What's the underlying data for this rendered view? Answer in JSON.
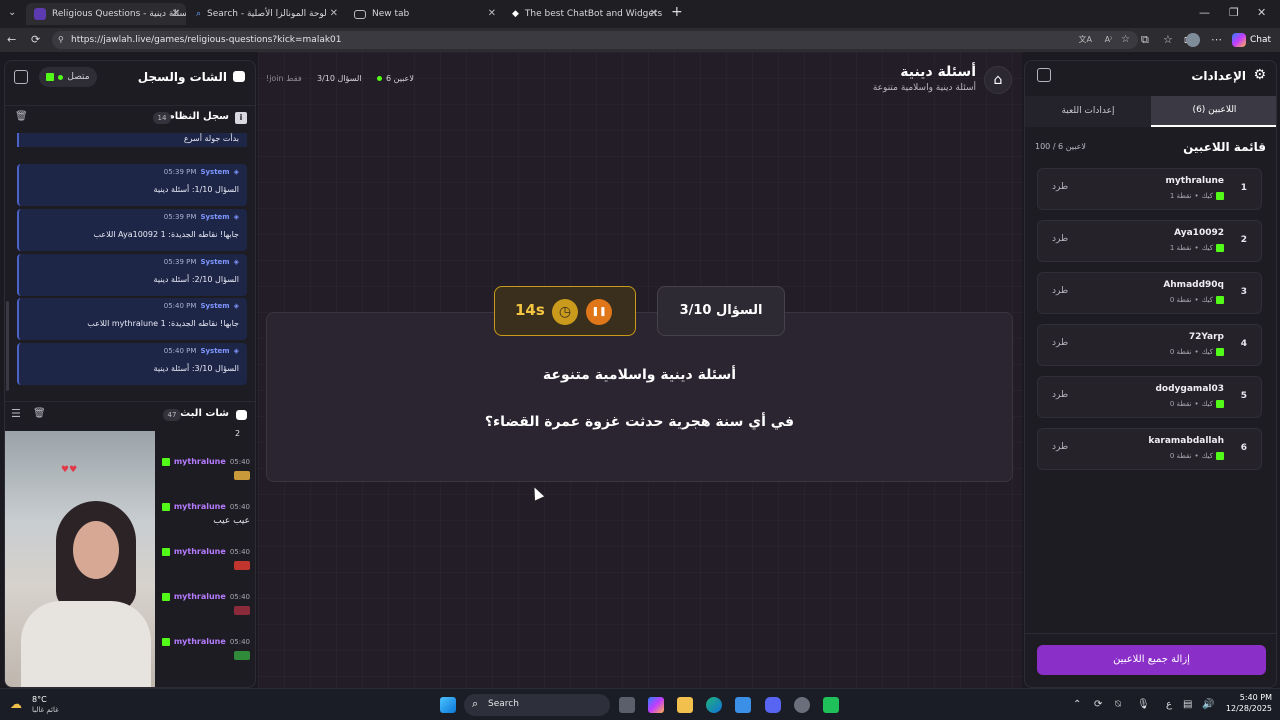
{
  "browser": {
    "tabs": [
      {
        "title": "Religious Questions - أسئلة دينية |",
        "active": true
      },
      {
        "title": "Search - لوحة المونالزا الأصلية"
      },
      {
        "title": "New tab"
      },
      {
        "title": "The best ChatBot and Widgets for"
      }
    ],
    "url": "https://jawlah.live/games/religious-questions?kick=malak01",
    "copilot_label": "Chat"
  },
  "chat_panel": {
    "title": "الشات والسجل",
    "status": "متصل",
    "system_log": {
      "title": "سجل النظام",
      "count": "14",
      "partial_text": "بدأت جولة أسرع",
      "messages": [
        {
          "sender": "System",
          "time": "05:39 PM",
          "text": "السؤال 1/10: أسئلة دينية"
        },
        {
          "sender": "System",
          "time": "05:39 PM",
          "text": "اللاعب Aya10092 جابها! نقاطه الجديدة: 1"
        },
        {
          "sender": "System",
          "time": "05:39 PM",
          "text": "السؤال 2/10: أسئلة دينية"
        },
        {
          "sender": "System",
          "time": "05:40 PM",
          "text": "اللاعب mythralune جابها! نقاطه الجديدة: 1"
        },
        {
          "sender": "System",
          "time": "05:40 PM",
          "text": "السؤال 3/10: أسئلة دينية"
        }
      ]
    },
    "stream_chat": {
      "title": "شات البث",
      "count": "47",
      "partial_text": "2",
      "messages": [
        {
          "time": "05:40",
          "user": "mythralune",
          "text": "",
          "emote": "#c99a3a"
        },
        {
          "time": "05:40",
          "user": "mythralune",
          "text": "عيب عيب",
          "emote": ""
        },
        {
          "time": "05:40",
          "user": "mythralune",
          "text": "",
          "emote": "#c2352f"
        },
        {
          "time": "05:40",
          "user": "mythralune",
          "text": "",
          "emote": "#8a2a3a"
        },
        {
          "time": "05:40",
          "user": "mythralune",
          "text": "",
          "emote": "#2f8a3a"
        }
      ]
    }
  },
  "game_header": {
    "title": "أسئلة دينية",
    "subtitle": "أسئلة دينية واسلامية متنوعة",
    "players_online": "6 لاعبين",
    "question_progress": "السؤال 3/10",
    "join_hint": "!join فقط"
  },
  "question": {
    "counter": "السؤال 3/10",
    "timer": "14s",
    "category": "أسئلة دينية واسلامية متنوعة",
    "text": "في أي سنة هجرية حدثت غزوة عمرة القضاء؟"
  },
  "settings": {
    "title": "الإعدادات",
    "tabs": [
      {
        "label": "اللاعبين (6)",
        "active": true
      },
      {
        "label": "إعدادات اللعبة",
        "active": false
      }
    ],
    "players_list_title": "قائمة اللاعبين",
    "players_count": "100 / 6 لاعبين",
    "kick_label": "طرد",
    "platform_label": "كيك",
    "players": [
      {
        "rank": "1",
        "name": "mythralune",
        "points": "1 نقطة"
      },
      {
        "rank": "2",
        "name": "Aya10092",
        "points": "1 نقطة"
      },
      {
        "rank": "3",
        "name": "Ahmadd90q",
        "points": "0 نقطة"
      },
      {
        "rank": "4",
        "name": "72Yarp",
        "points": "0 نقطة"
      },
      {
        "rank": "5",
        "name": "dodygamal03",
        "points": "0 نقطة"
      },
      {
        "rank": "6",
        "name": "karamabdallah",
        "points": "0 نقطة"
      }
    ],
    "remove_all_label": "إزالة جميع اللاعبين"
  },
  "taskbar": {
    "weather_temp": "8°C",
    "weather_desc": "غائم غالبا",
    "search_placeholder": "Search",
    "time": "5:40 PM",
    "date": "12/28/2025",
    "lang": "ع"
  },
  "colors": {
    "accent_purple": "#8b2fc9",
    "kick_green": "#53fc18",
    "timer_gold": "#c99a1c",
    "system_blue": "#4b63c9"
  }
}
